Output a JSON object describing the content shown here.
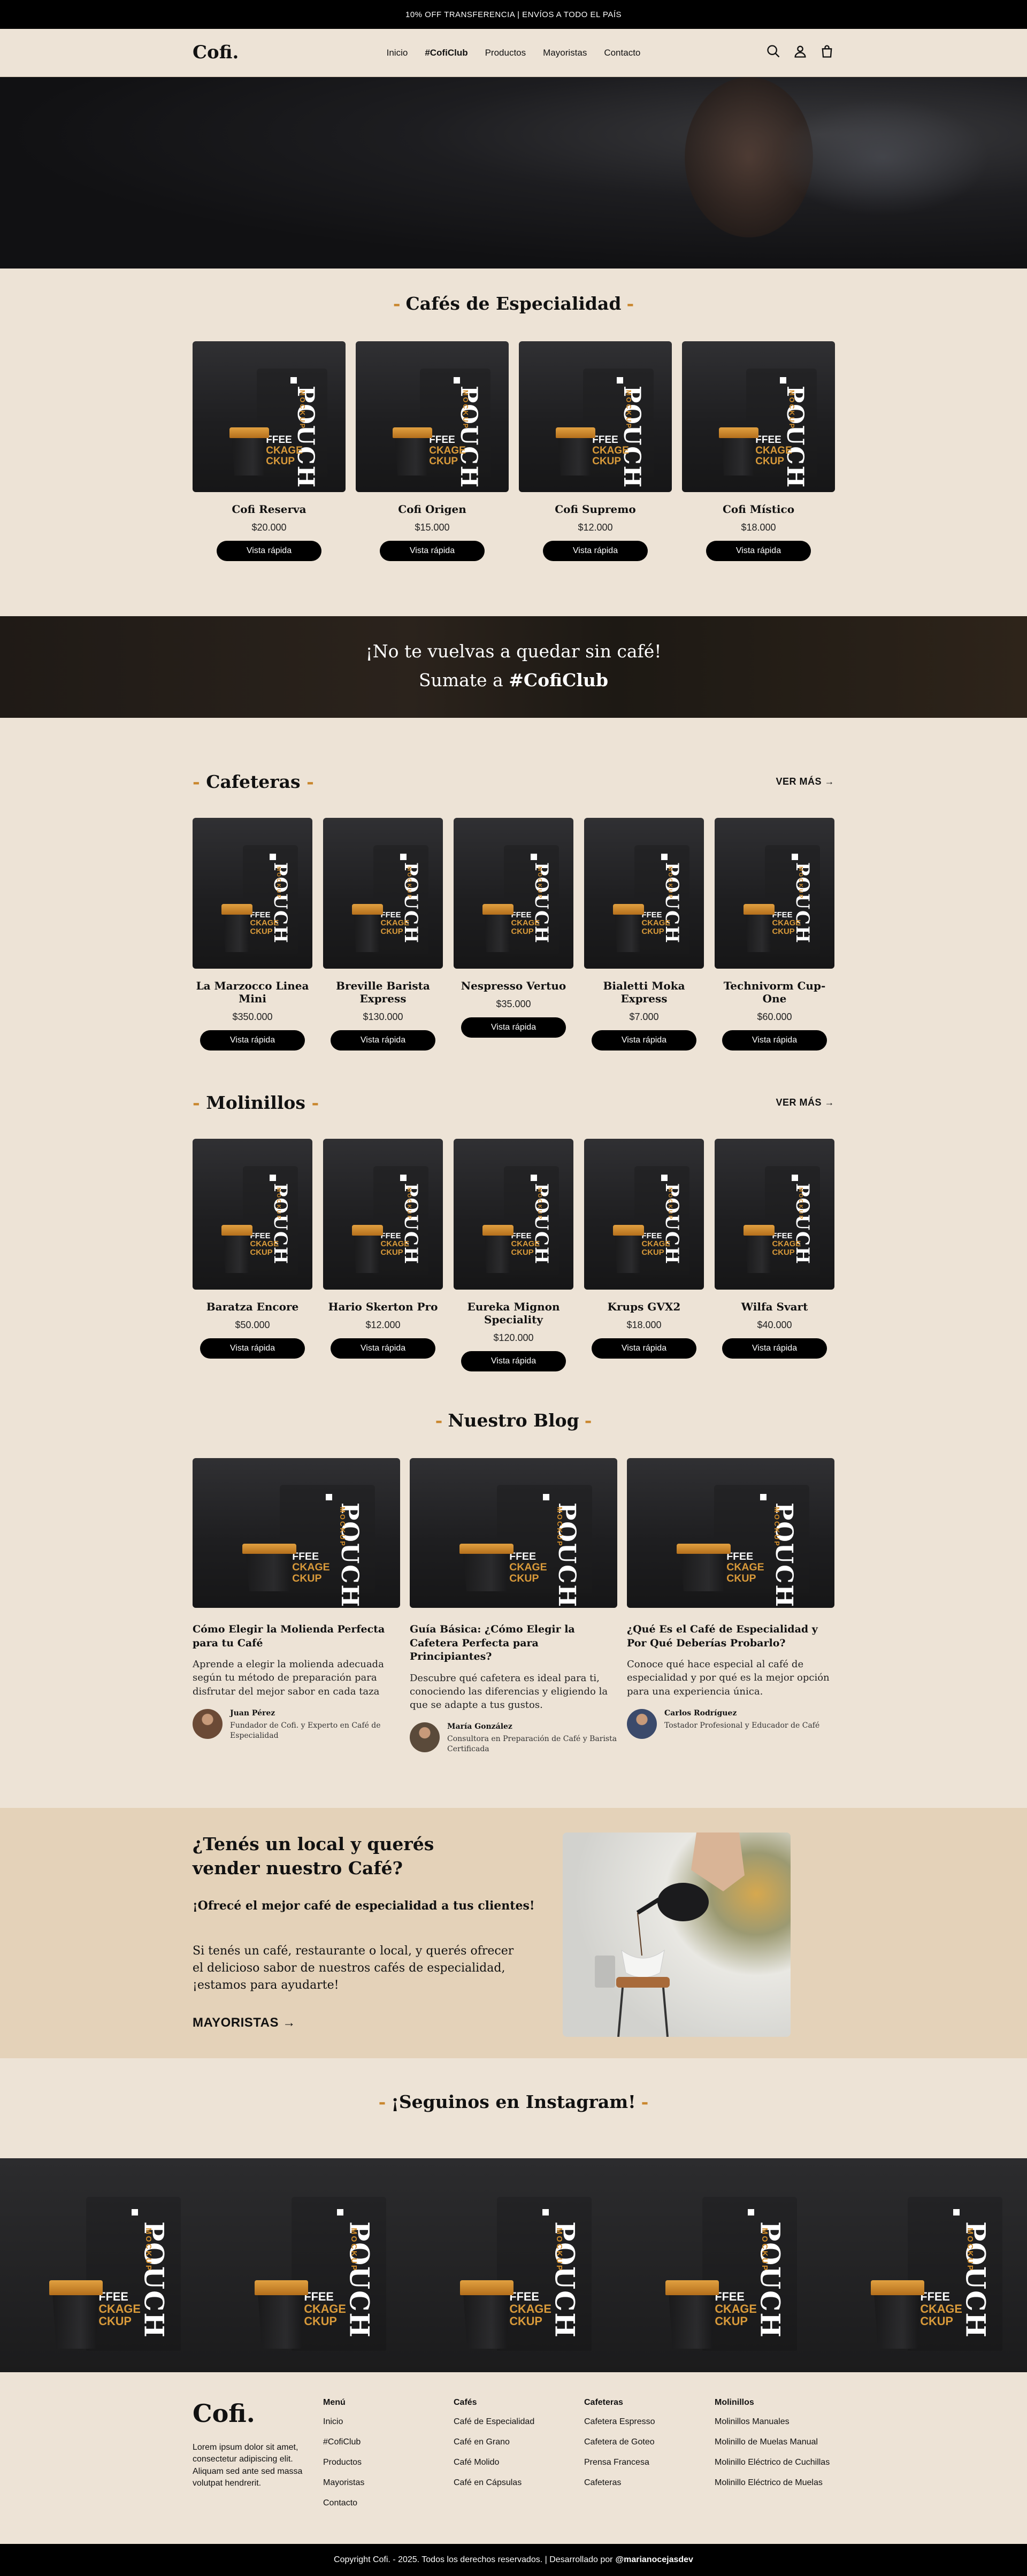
{
  "topbar": {
    "text": "10% OFF TRANSFERENCIA | ENVÍOS A TODO EL PAÍS"
  },
  "header": {
    "logo": "Cofi.",
    "nav": [
      "Inicio",
      "#CofiClub",
      "Productos",
      "Mayoristas",
      "Contacto"
    ],
    "icons": [
      "search-icon",
      "user-icon",
      "cart-icon"
    ]
  },
  "especialidad": {
    "title": "Cafés de Especialidad",
    "products": [
      {
        "name": "Cofi Reserva",
        "price": "$20.000"
      },
      {
        "name": "Cofi Origen",
        "price": "$15.000"
      },
      {
        "name": "Cofi Supremo",
        "price": "$12.000"
      },
      {
        "name": "Cofi Místico",
        "price": "$18.000"
      }
    ]
  },
  "quick_view_label": "Vista rápida",
  "banner": {
    "line1": "¡No te vuelvas a quedar sin café!",
    "line2_prefix": "Sumate a ",
    "line2_bold": "#CofiClub"
  },
  "cafeteras": {
    "title": "Cafeteras",
    "more": "VER MÁS →",
    "products": [
      {
        "name": "La Marzocco Linea Mini",
        "price": "$350.000"
      },
      {
        "name": "Breville Barista Express",
        "price": "$130.000"
      },
      {
        "name": "Nespresso Vertuo",
        "price": "$35.000"
      },
      {
        "name": "Bialetti Moka Express",
        "price": "$7.000"
      },
      {
        "name": "Technivorm Cup-One",
        "price": "$60.000"
      }
    ]
  },
  "molinillos": {
    "title": "Molinillos",
    "more": "VER MÁS →",
    "products": [
      {
        "name": "Baratza Encore",
        "price": "$50.000"
      },
      {
        "name": "Hario Skerton Pro",
        "price": "$12.000"
      },
      {
        "name": "Eureka Mignon Speciality",
        "price": "$120.000"
      },
      {
        "name": "Krups GVX2",
        "price": "$18.000"
      },
      {
        "name": "Wilfa Svart",
        "price": "$40.000"
      }
    ]
  },
  "blog": {
    "title": "Nuestro Blog",
    "posts": [
      {
        "title": "Cómo Elegir la Molienda Perfecta para tu Café",
        "excerpt": "Aprende a elegir la molienda adecuada según tu método de preparación para disfrutar del mejor sabor en cada taza",
        "author": "Juan Pérez",
        "role": "Fundador de Cofi. y Experto en Café de Especialidad"
      },
      {
        "title": "Guía Básica: ¿Cómo Elegir la Cafetera Perfecta para Principiantes?",
        "excerpt": "Descubre qué cafetera es ideal para ti, conociendo las diferencias y eligiendo la que se adapte a tus gustos.",
        "author": "María González",
        "role": "Consultora en Preparación de Café y Barista Certificada"
      },
      {
        "title": "¿Qué Es el Café de Especialidad y Por Qué Deberías Probarlo?",
        "excerpt": "Conoce qué hace especial al café de especialidad y por qué es la mejor opción para una experiencia única.",
        "author": "Carlos Rodríguez",
        "role": "Tostador Profesional y Educador de Café"
      }
    ]
  },
  "mayoristas": {
    "title": "¿Tenés un local y querés vender nuestro Café?",
    "subtitle": "¡Ofrecé el mejor café de especialidad a tus clientes!",
    "text": "Si tenés un café, restaurante o local, y querés ofrecer el delicioso sabor de nuestros cafés de especialidad, ¡estamos para ayudarte!",
    "link": "MAYORISTAS →"
  },
  "instagram": {
    "title": "¡Seguinos en Instagram!"
  },
  "footer": {
    "logo": "Cofi.",
    "description": "Lorem ipsum dolor sit amet, consectetur adipiscing elit. Aliquam sed ante sed massa volutpat hendrerit.",
    "columns": [
      {
        "title": "Menú",
        "links": [
          "Inicio",
          "#CofiClub",
          "Productos",
          "Mayoristas",
          "Contacto"
        ]
      },
      {
        "title": "Cafés",
        "links": [
          "Café de Especialidad",
          "Café en Grano",
          "Café Molido",
          "Café en Cápsulas"
        ]
      },
      {
        "title": "Cafeteras",
        "links": [
          "Cafetera Espresso",
          "Cafetera de Goteo",
          "Prensa Francesa",
          "Cafeteras"
        ]
      },
      {
        "title": "Molinillos",
        "links": [
          "Molinillos Manuales",
          "Molinillo de Muelas Manual",
          "Molinillo Eléctrico de Cuchillas",
          "Molinillo Eléctrico de Muelas"
        ]
      }
    ],
    "copyright": "Copyright Cofi. - 2025. Todos los derechos reservados. | Desarrollado por",
    "developer": "@marianocejasdev"
  },
  "mock": {
    "pouch": "POUCH",
    "mockup": "MOCKUP",
    "pack": [
      "FFEE",
      "CKAGE",
      "CKUP"
    ]
  },
  "colors": {
    "accent": "#c9862c",
    "background": "#ede3d6",
    "mayoristas_bg": "#e4d2b9"
  }
}
